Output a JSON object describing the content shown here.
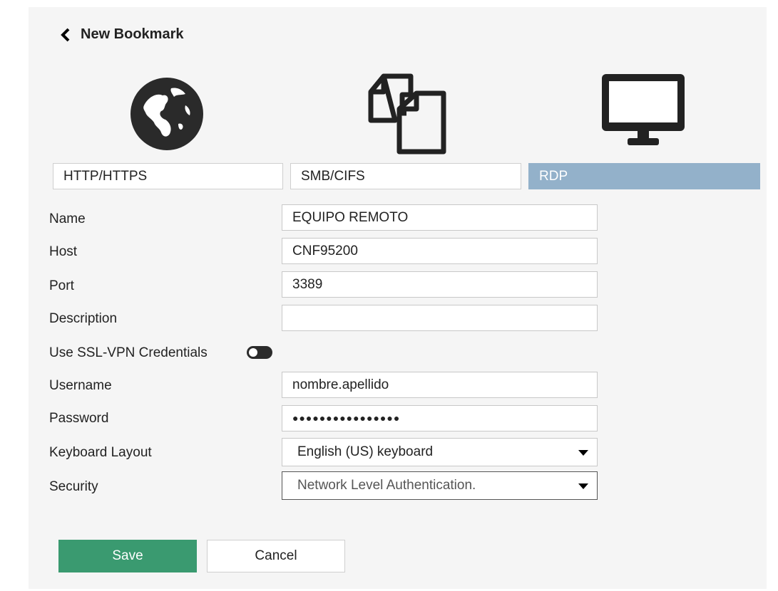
{
  "header": {
    "title": "New Bookmark",
    "back_icon": "chevron-left-icon"
  },
  "types": {
    "icons": [
      "globe-icon",
      "files-icon",
      "monitor-icon"
    ],
    "http": "HTTP/HTTPS",
    "smb": "SMB/CIFS",
    "rdp": "RDP",
    "selected": "RDP",
    "selected_color": "#93b1ca"
  },
  "form": {
    "name_label": "Name",
    "name_value": "EQUIPO REMOTO",
    "host_label": "Host",
    "host_value": "CNF95200",
    "port_label": "Port",
    "port_value": "3389",
    "description_label": "Description",
    "description_value": "",
    "ssl_label": "Use SSL-VPN Credentials",
    "ssl_enabled": false,
    "username_label": "Username",
    "username_value": "nombre.apellido",
    "password_label": "Password",
    "password_value": "●●●●●●●●●●●●●●●●",
    "keyboard_label": "Keyboard Layout",
    "keyboard_value": "English (US) keyboard",
    "security_label": "Security",
    "security_value": "Network Level Authentication."
  },
  "buttons": {
    "save": "Save",
    "cancel": "Cancel",
    "save_color": "#3a9a70"
  }
}
